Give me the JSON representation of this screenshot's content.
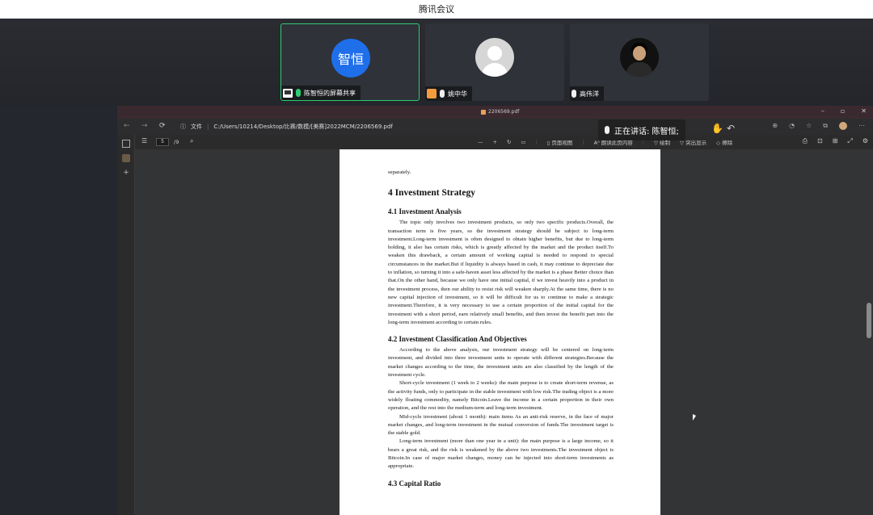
{
  "app": {
    "title": "腾讯会议"
  },
  "participants": [
    {
      "name": "陈智恒的屏幕共享",
      "avatar_text": "智恒",
      "avatar_color": "#1f6feb",
      "sharing": true
    },
    {
      "name": "姚中华"
    },
    {
      "name": "高伟洋"
    }
  ],
  "speaking": {
    "label": "正在讲话: 陈智恒;"
  },
  "browser": {
    "tab_title": "2206569.pdf",
    "win_controls": [
      "–",
      "▫",
      "✕"
    ],
    "address_file_label": "文件",
    "address_path": "C:/Users/10214/Desktop/比赛/数模/[美赛]2022MCM/2206569.pdf"
  },
  "pdf_toolbar": {
    "page_current": "5",
    "page_total": "/9",
    "zoom_out": "—",
    "zoom_in": "+",
    "page_view": "页面视图",
    "read_aloud": "A⁰ 朗读此页内容",
    "draw": "绘制",
    "highlight": "突出显示",
    "erase": "擦除"
  },
  "document": {
    "intro": "separately.",
    "section_title": "4    Investment Strategy",
    "sub1_title": "4.1    Investment Analysis",
    "sub1_body": "The topic only involves two investment products, so only two specific products.Overall, the transaction term is five years, so the investment strategy should be subject to long-term investment.Long-term investment is often designed to obtain higher benefits, but due to long-term holding, it also has certain risks, which is greatly affected by the market and the product itself.To weaken this drawback, a certain amount of working capital is needed to respond to special circumstances in the market.But if liquidity is always based in cash, it may continue to depreciate due to inflation, so turning it into a safe-haven asset less affected by the market is a phase Better choice than that.On the other hand, because we only have one initial capital, if we invest heavily into a product in the investment process, then our ability to resist risk will weaken sharply.At the same time, there is no new capital injection of investment, so it will be difficult for us to continue to make a strategic investment.Therefore, it is very necessary to use a certain proportion of the initial capital for the investment with a short period, earn relatively small benefits, and then invest the benefit part into the long-term investment according to certain rules.",
    "sub2_title": "4.2    Investment Classification And Objectives",
    "sub2_p1": "According to the above analysis, our investment strategy will be centered on long-term investment, and divided into three investment units to operate with different strategies.Because the market changes according to the time, the investment units are also classified by the length of the investment cycle.",
    "sub2_p2": "Short-cycle investment (1 week to 2 weeks): the main purpose is to create short-term revenue, as the activity funds, only to participate in the stable investment with low risk.The trading object is a more widely floating commodity, namely Bitcoin.Leave the income in a certain proportion in their own operation, and the rest into the medium-term and long-term investment.",
    "sub2_p3": "Mid-cycle investment (about 1 month): main items As an anti-risk reserve, in the face of major market changes, and long-term investment in the mutual conversion of funds.The investment target is the stable gold.",
    "sub2_p4": "Long-term investment (more than one year in a unit): the main purpose is a large income, so it bears a great risk, and the risk is weakened by the above two investments.The investment object is Bitcoin.In case of major market changes, money can be injected into short-term investments as appropriate.",
    "sub3_title": "4.3    Capital Ratio"
  }
}
